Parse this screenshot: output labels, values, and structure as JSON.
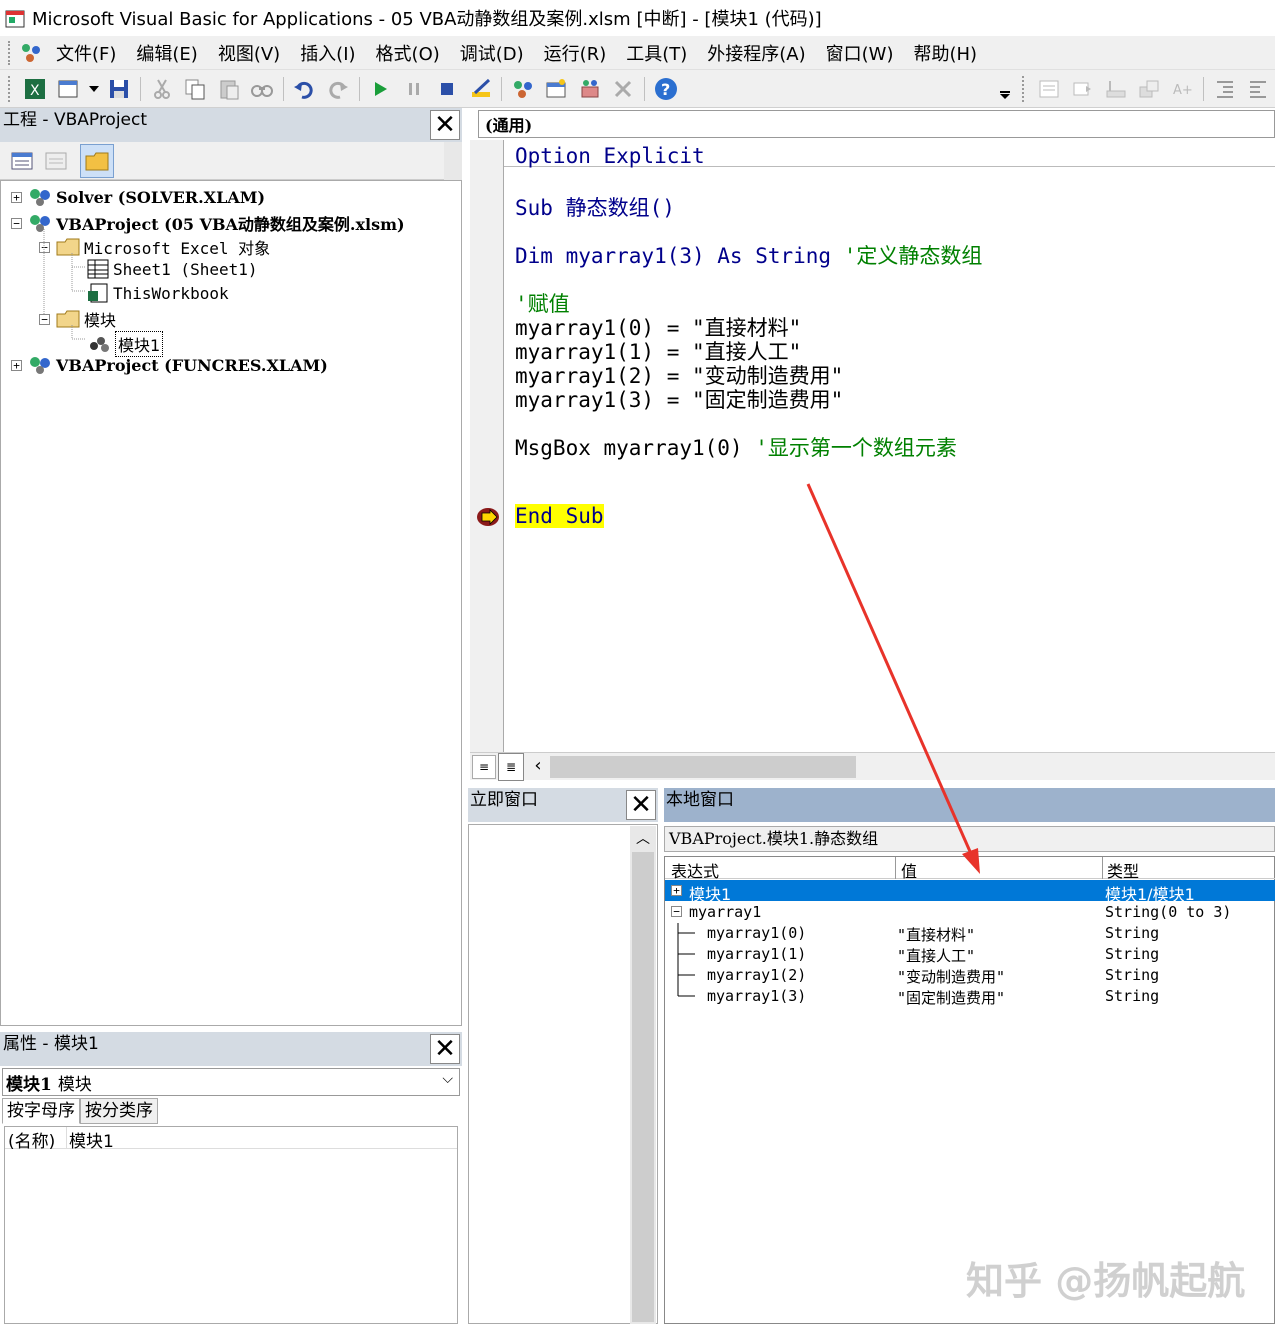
{
  "window": {
    "title": "Microsoft Visual Basic for Applications - 05 VBA动静数组及案例.xlsm [中断] - [模块1 (代码)]"
  },
  "menu": {
    "items": [
      "文件(F)",
      "编辑(E)",
      "视图(V)",
      "插入(I)",
      "格式(O)",
      "调试(D)",
      "运行(R)",
      "工具(T)",
      "外接程序(A)",
      "窗口(W)",
      "帮助(H)"
    ]
  },
  "toolbar": {
    "icons": [
      "excel-icon",
      "insert-module-icon",
      "dropdown-icon",
      "save-icon",
      "cut-icon",
      "copy-icon",
      "paste-icon",
      "find-icon",
      "undo-icon",
      "redo-icon",
      "run-icon",
      "break-icon",
      "reset-icon",
      "design-mode-icon",
      "project-explorer-icon",
      "properties-icon",
      "object-browser-icon",
      "toolbox-icon",
      "help-icon"
    ],
    "help_glyph": "?"
  },
  "project": {
    "title": "工程 - VBAProject",
    "nodes": [
      {
        "label": "Solver (SOLVER.XLAM)",
        "toggle": "+"
      },
      {
        "label": "VBAProject (05 VBA动静数组及案例.xlsm)",
        "toggle": "−"
      },
      {
        "label": "Microsoft Excel 对象",
        "toggle": "−"
      },
      {
        "label": "Sheet1 (Sheet1)"
      },
      {
        "label": "ThisWorkbook"
      },
      {
        "label": "模块",
        "toggle": "−"
      },
      {
        "label": "模块1"
      },
      {
        "label": "VBAProject (FUNCRES.XLAM)",
        "toggle": "+"
      }
    ]
  },
  "properties": {
    "title": "属性 - 模块1",
    "object_name": "模块1",
    "object_type": "模块",
    "tabs": [
      "按字母序",
      "按分类序"
    ],
    "rows": [
      {
        "name": "(名称)",
        "value": "模块1"
      }
    ]
  },
  "code": {
    "scope": "(通用)",
    "lines": {
      "l1": "Option Explicit",
      "l2": "Sub 静态数组()",
      "l3_code": "Dim myarray1(3) As String ",
      "l3_comment": "'定义静态数组",
      "l4": "'赋值",
      "l5": "myarray1(0) = \"直接材料\"",
      "l6": "myarray1(1) = \"直接人工\"",
      "l7": "myarray1(2) = \"变动制造费用\"",
      "l8": "myarray1(3) = \"固定制造费用\"",
      "l9_code": "MsgBox myarray1(0) ",
      "l9_comment": "'显示第一个数组元素",
      "l10": "End Sub"
    }
  },
  "immediate": {
    "title": "立即窗口"
  },
  "locals": {
    "title": "本地窗口",
    "context": "VBAProject.模块1.静态数组",
    "headers": {
      "expr": "表达式",
      "value": "值",
      "type": "类型"
    },
    "rows": [
      {
        "expr": "模块1",
        "value": "",
        "type": "模块1/模块1",
        "toggle": "+"
      },
      {
        "expr": "myarray1",
        "value": "",
        "type": "String(0 to 3)",
        "toggle": "−"
      },
      {
        "expr": "myarray1(0)",
        "value": "\"直接材料\"",
        "type": "String"
      },
      {
        "expr": "myarray1(1)",
        "value": "\"直接人工\"",
        "type": "String"
      },
      {
        "expr": "myarray1(2)",
        "value": "\"变动制造费用\"",
        "type": "String"
      },
      {
        "expr": "myarray1(3)",
        "value": "\"固定制造费用\"",
        "type": "String"
      }
    ]
  },
  "watermark": "知乎 @扬帆起航",
  "colors": {
    "selection": "#0078d7",
    "keyword": "#00008b",
    "comment": "#008000",
    "highlight": "#ffff00",
    "arrow": "#e8332a"
  }
}
